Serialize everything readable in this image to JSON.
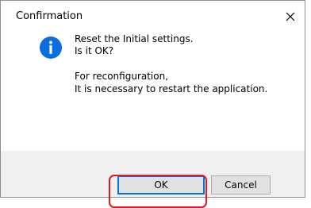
{
  "window": {
    "title": "Confirmation"
  },
  "icons": {
    "close": "close-icon",
    "info": "information-icon"
  },
  "message": {
    "line1": "Reset the Initial settings.",
    "line2": "Is it OK?",
    "line3": "For reconfiguration,",
    "line4": "It is necessary to restart the application."
  },
  "buttons": {
    "ok_label": "OK",
    "cancel_label": "Cancel"
  },
  "colors": {
    "info_icon": "#0a6ee0",
    "default_button_border": "#0078d7",
    "highlight": "#e0182a",
    "footer": "#f0f0f0"
  }
}
